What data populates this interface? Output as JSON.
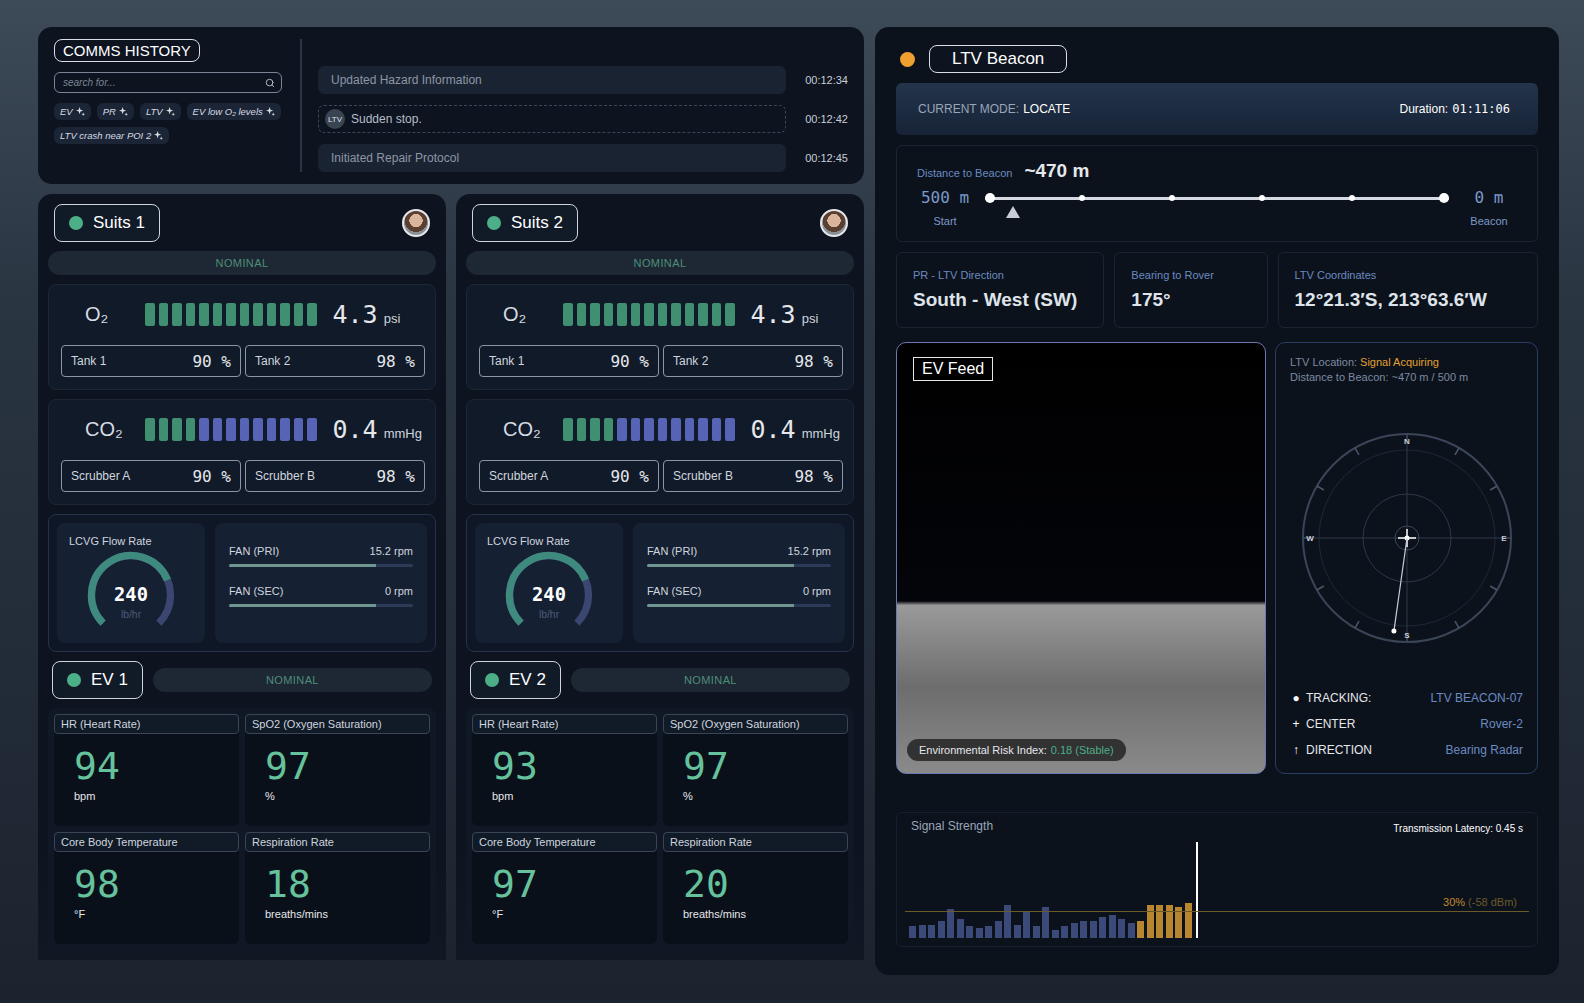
{
  "comms": {
    "title": "COMMS HISTORY",
    "search": {
      "placeholder": "search for..."
    },
    "tags": [
      "EV",
      "PR",
      "LTV",
      "EV low O₂ levels",
      "LTV crash near POI 2"
    ],
    "messages": [
      {
        "text": "Updated Hazard Information",
        "time": "00:12:34",
        "badge": "",
        "selected": false
      },
      {
        "text": "Sudden stop.",
        "time": "00:12:42",
        "badge": "LTV",
        "selected": true
      },
      {
        "text": "Initiated Repair Protocol",
        "time": "00:12:45",
        "badge": "",
        "selected": false
      }
    ]
  },
  "suits": [
    {
      "name": "Suits 1",
      "status": "NOMINAL",
      "meters": [
        {
          "label": "O₂",
          "value": "4.3",
          "unit": "psi",
          "segments": 13,
          "level": 1,
          "subs": [
            {
              "label": "Tank 1",
              "value": "90 %"
            },
            {
              "label": "Tank 2",
              "value": "98 %"
            }
          ]
        },
        {
          "label": "CO₂",
          "value": "0.4",
          "unit": "mmHg",
          "segments": 13,
          "level": 0.31,
          "subs": [
            {
              "label": "Scrubber A",
              "value": "90 %"
            },
            {
              "label": "Scrubber B",
              "value": "98 %"
            }
          ]
        }
      ],
      "lcvg": {
        "label": "LCVG Flow Rate",
        "value": "240",
        "unit": "lb/hr",
        "level": 0.75
      },
      "fans": [
        {
          "label": "FAN (PRI)",
          "value": "15.2 rpm",
          "level": 0.8
        },
        {
          "label": "FAN (SEC)",
          "value": "0 rpm",
          "level": 0.8
        }
      ],
      "ev": {
        "name": "EV 1",
        "status": "NOMINAL",
        "vitals": [
          {
            "label": "HR (Heart Rate)",
            "value": "94",
            "unit": "bpm"
          },
          {
            "label": "SpO2 (Oxygen Saturation)",
            "value": "97",
            "unit": "%"
          },
          {
            "label": "Core Body Temperature",
            "value": "98",
            "unit": "°F"
          },
          {
            "label": "Respiration Rate",
            "value": "18",
            "unit": "breaths/mins"
          }
        ]
      }
    },
    {
      "name": "Suits 2",
      "status": "NOMINAL",
      "meters": [
        {
          "label": "O₂",
          "value": "4.3",
          "unit": "psi",
          "segments": 13,
          "level": 1,
          "subs": [
            {
              "label": "Tank 1",
              "value": "90 %"
            },
            {
              "label": "Tank 2",
              "value": "98 %"
            }
          ]
        },
        {
          "label": "CO₂",
          "value": "0.4",
          "unit": "mmHg",
          "segments": 13,
          "level": 0.31,
          "subs": [
            {
              "label": "Scrubber A",
              "value": "90 %"
            },
            {
              "label": "Scrubber B",
              "value": "98 %"
            }
          ]
        }
      ],
      "lcvg": {
        "label": "LCVG Flow Rate",
        "value": "240",
        "unit": "lb/hr",
        "level": 0.75
      },
      "fans": [
        {
          "label": "FAN (PRI)",
          "value": "15.2 rpm",
          "level": 0.8
        },
        {
          "label": "FAN (SEC)",
          "value": "0 rpm",
          "level": 0.8
        }
      ],
      "ev": {
        "name": "EV 2",
        "status": "NOMINAL",
        "vitals": [
          {
            "label": "HR (Heart Rate)",
            "value": "93",
            "unit": "bpm"
          },
          {
            "label": "SpO2 (Oxygen Saturation)",
            "value": "97",
            "unit": "%"
          },
          {
            "label": "Core Body Temperature",
            "value": "97",
            "unit": "°F"
          },
          {
            "label": "Respiration Rate",
            "value": "20",
            "unit": "breaths/mins"
          }
        ]
      }
    }
  ],
  "beacon": {
    "title": "LTV Beacon",
    "mode_label": "CURRENT MODE:",
    "mode": "LOCATE",
    "duration_label": "Duration:",
    "duration": "01:11:06",
    "distance": {
      "label": "Distance to Beacon",
      "value": "~470 m",
      "start_value": "500 m",
      "start_label": "Start",
      "end_value": "0 m",
      "end_label": "Beacon",
      "stops": 6,
      "level": 0.06
    },
    "info": [
      {
        "label": "PR - LTV Direction",
        "value": "South - West (SW)"
      },
      {
        "label": "Bearing to Rover",
        "value": "175°"
      },
      {
        "label": "LTV Coordinates",
        "value": "12°21.3′S, 213°63.6′W"
      }
    ],
    "feed": {
      "label": "EV Feed",
      "risk_label": "Environmental Risk Index:",
      "risk_value": "0.18 (Stable)"
    },
    "radar": {
      "location_label": "LTV Location:",
      "location_value": "Signal Acquiring",
      "distance": "Distance to Beacon: ~470 m / 500 m",
      "compass": [
        "N",
        "E",
        "S",
        "W"
      ],
      "needle_deg": 188,
      "legend": [
        {
          "icon": "●",
          "label": "TRACKING:",
          "value": "LTV BEACON-07"
        },
        {
          "icon": "+",
          "label": "CENTER",
          "value": "Rover-2"
        },
        {
          "icon": "↑",
          "label": "DIRECTION",
          "value": "Bearing Radar"
        }
      ]
    },
    "signal": {
      "title": "Signal Strength",
      "latency": "Transmission Latency: 0.45 s",
      "reading": "30%",
      "reading_detail": "(-58 dBm)",
      "threshold": 27,
      "highlight_last": 6,
      "bars": [
        12,
        14,
        14,
        18,
        30,
        20,
        12,
        10,
        12,
        18,
        34,
        14,
        28,
        12,
        32,
        8,
        12,
        16,
        18,
        18,
        22,
        24,
        20,
        16,
        18,
        34,
        34,
        34,
        32,
        36
      ]
    }
  }
}
